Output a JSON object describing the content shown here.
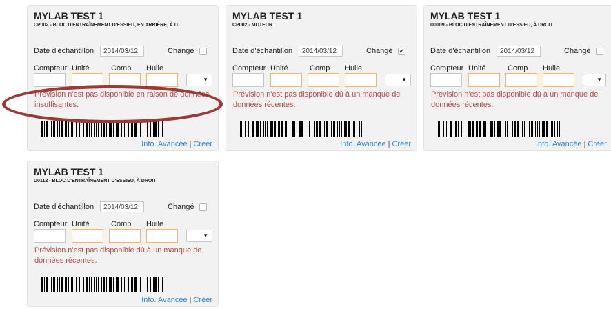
{
  "cards": [
    {
      "title": "MYLAB TEST 1",
      "subtitle": "CP002 - BLOC D'ENTRAÎNEMENT D'ESSIEU, EN ARRIÈRE, À D...",
      "date_label": "Date d'échantillon",
      "date_value": "2014/03/12",
      "changed_label": "Changé",
      "changed_checked": false,
      "changed_glyph": "",
      "counter_label": "Compteur",
      "unit_label": "Unité",
      "comp_label": "Comp",
      "oil_label": "Huile",
      "select_arrow": "▼",
      "message": "Prévision n'est pas disponible en raison de données insuffisantes.",
      "advanced_link": "Info. Avancée",
      "separator": "|",
      "create_link": "Créer"
    },
    {
      "title": "MYLAB TEST 1",
      "subtitle": "CP002 - MOTEUR",
      "date_label": "Date d'échantillon",
      "date_value": "2014/03/12",
      "changed_label": "Changé",
      "changed_checked": true,
      "changed_glyph": "✔",
      "counter_label": "Compteur",
      "unit_label": "Unité",
      "comp_label": "Comp",
      "oil_label": "Huile",
      "select_arrow": "▼",
      "message": "Prévision n'est pas disponible dû à un manque de données récentes.",
      "advanced_link": "Info. Avancée",
      "separator": "|",
      "create_link": "Créer"
    },
    {
      "title": "MYLAB TEST 1",
      "subtitle": "D0109 - BLOC D'ENTRAÎNEMENT D'ESSIEU, À DROIT",
      "date_label": "Date d'échantillon",
      "date_value": "2014/03/12",
      "changed_label": "Changé",
      "changed_checked": false,
      "changed_glyph": "",
      "counter_label": "Compteur",
      "unit_label": "Unité",
      "comp_label": "Comp",
      "oil_label": "Huile",
      "select_arrow": "▼",
      "message": "Prévision n'est pas disponible dû à un manque de données récentes.",
      "advanced_link": "Info. Avancée",
      "separator": "|",
      "create_link": "Créer"
    },
    {
      "title": "MYLAB TEST 1",
      "subtitle": "D0112 - BLOC D'ENTRAÎNEMENT D'ESSIEU, À DROIT",
      "date_label": "Date d'échantillon",
      "date_value": "2014/03/12",
      "changed_label": "Changé",
      "changed_checked": false,
      "changed_glyph": "",
      "counter_label": "Compteur",
      "unit_label": "Unité",
      "comp_label": "Comp",
      "oil_label": "Huile",
      "select_arrow": "▼",
      "message": "Prévision n'est pas disponible dû à un manque de données récentes.",
      "advanced_link": "Info. Avancée",
      "separator": "|",
      "create_link": "Créer"
    }
  ],
  "colors": {
    "warning_text": "#b94a48",
    "link": "#2f87d4",
    "highlight_oval": "#9b3a37",
    "input_border_orange": "#f5b56a"
  }
}
